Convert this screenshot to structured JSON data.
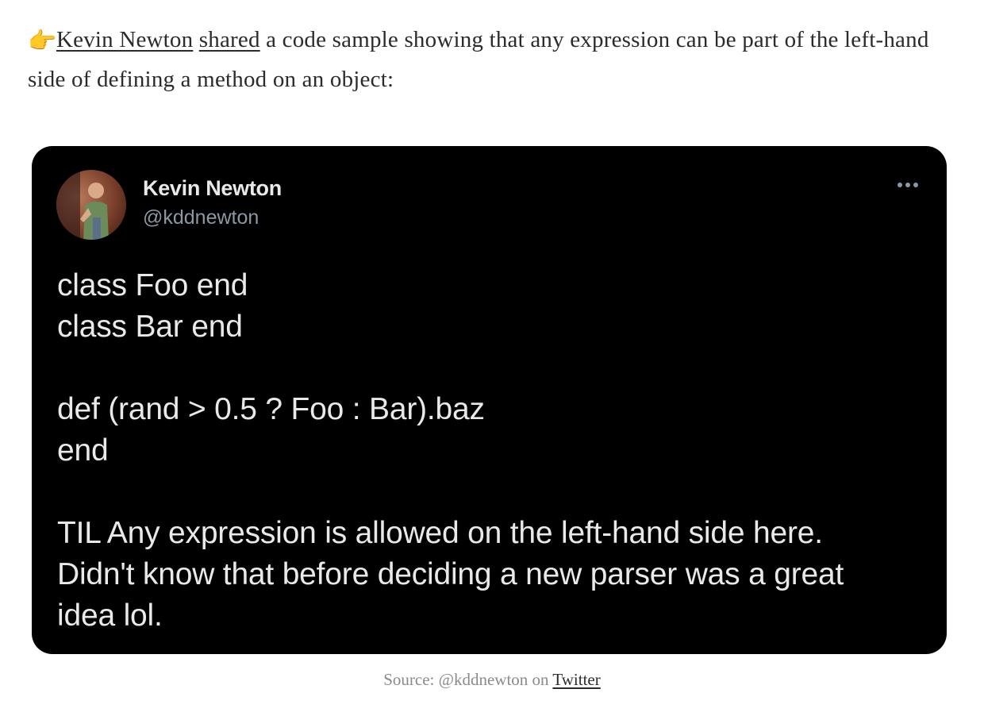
{
  "intro": {
    "emoji": "👉",
    "author_link": "Kevin Newton",
    "space1": " ",
    "shared_link": "shared",
    "text": " a code sample showing that any expression can be part of the left-hand side of defining a method on an object:"
  },
  "tweet": {
    "author_name": "Kevin Newton",
    "author_handle": "@kddnewton",
    "more_icon": "more-horizontal-icon",
    "lines": [
      "class Foo end",
      "class Bar end",
      "",
      "def (rand > 0.5 ? Foo : Bar).baz",
      "end",
      "",
      "TIL Any expression is allowed on the left-hand side here.",
      "Didn't know that before deciding a new parser was a great",
      "idea lol."
    ]
  },
  "caption": {
    "prefix": "Source: @kddnewton on ",
    "link": "Twitter"
  }
}
